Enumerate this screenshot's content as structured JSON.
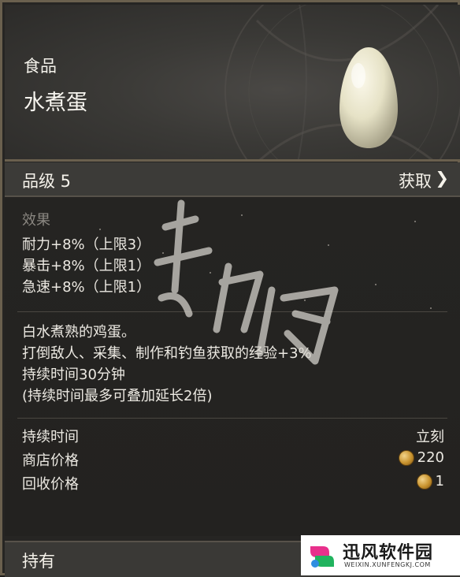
{
  "header": {
    "category": "食品",
    "item_name": "水煮蛋"
  },
  "grade": {
    "label": "品级 5",
    "obtain_label": "获取"
  },
  "effects": {
    "title": "效果",
    "lines": [
      "耐力+8%（上限3）",
      "暴击+8%（上限1）",
      "急速+8%（上限1）"
    ]
  },
  "description": {
    "lines": [
      "白水煮熟的鸡蛋。",
      "打倒敌人、采集、制作和钓鱼获取的经验+3%",
      "持续时间30分钟",
      "(持续时间最多可叠加延长2倍)"
    ]
  },
  "stats": [
    {
      "label": "持续时间",
      "value": "立刻"
    },
    {
      "label": "商店价格",
      "value": "220"
    },
    {
      "label": "回收价格",
      "value": "1"
    }
  ],
  "footer": {
    "label": "持有"
  },
  "logo": {
    "cn": "迅风软件园",
    "en": "WEIXIN.XUNFENGKJ.COM"
  },
  "colors": {
    "border": "#6a604e",
    "panel": "#262523",
    "text": "#ece9e2",
    "muted": "#8a8781",
    "coin": "#c8932e"
  }
}
